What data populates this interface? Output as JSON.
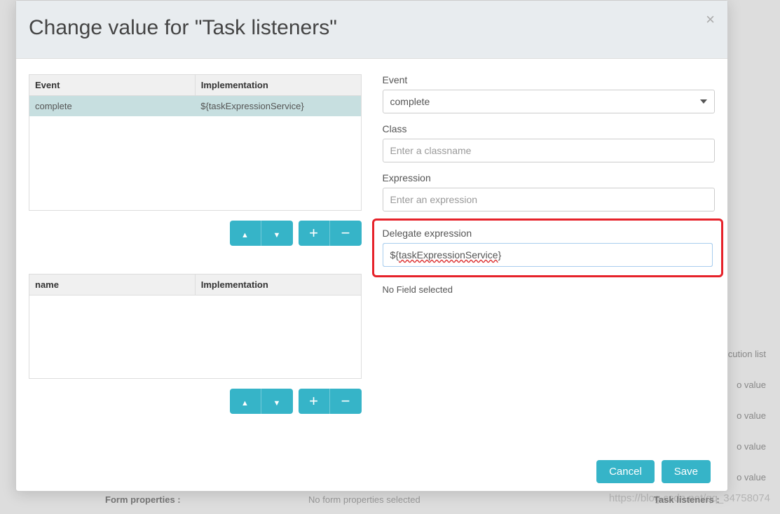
{
  "modal": {
    "title": "Change value for \"Task listeners\""
  },
  "listeners_table": {
    "headers": {
      "event": "Event",
      "implementation": "Implementation"
    },
    "rows": [
      {
        "event": "complete",
        "implementation": "${taskExpressionService}"
      }
    ]
  },
  "fields_table": {
    "headers": {
      "name": "name",
      "implementation": "Implementation"
    }
  },
  "form": {
    "event": {
      "label": "Event",
      "value": "complete"
    },
    "class": {
      "label": "Class",
      "placeholder": "Enter a classname",
      "value": ""
    },
    "expression": {
      "label": "Expression",
      "placeholder": "Enter an expression",
      "value": ""
    },
    "delegate_expression": {
      "label": "Delegate expression",
      "value": "${taskExpressionService}",
      "display_prefix": "${",
      "display_spellcheck": "taskExpressionService",
      "display_suffix": "}"
    },
    "field_status": "No Field selected"
  },
  "buttons": {
    "cancel": "Cancel",
    "save": "Save"
  },
  "background": {
    "form_properties_label": "Form properties :",
    "form_properties_value": "No form properties selected",
    "task_listeners_label": "Task listeners :",
    "right_items": [
      "o execution list",
      "o value",
      "o value",
      "o value",
      "o value"
    ]
  },
  "watermark": "https://blog.csdn.net/qq_34758074"
}
